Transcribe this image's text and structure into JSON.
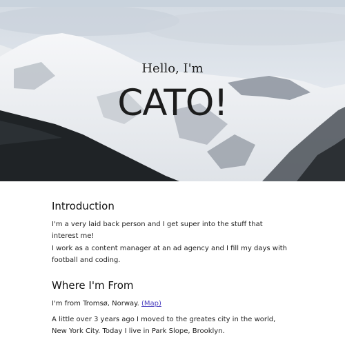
{
  "hero": {
    "greeting": "Hello, I'm",
    "name": "CATO!"
  },
  "introduction": {
    "heading": "Introduction",
    "paragraph1": "I'm a very laid back person and I get super into the stuff that interest me!",
    "paragraph2": "I work as a content manager at an ad agency and I fill my days with football and coding."
  },
  "origin": {
    "heading": "Where I'm From",
    "from_text": "I'm from Tromsø, Norway. ",
    "map_link": "(Map)",
    "paragraph2": "A little over 3 years ago I moved to the greates city in the world, New York City. Today I live in Park Slope, Brooklyn."
  },
  "colors": {
    "link": "#4a3fbf",
    "top_bar": "#c9d3dd"
  }
}
